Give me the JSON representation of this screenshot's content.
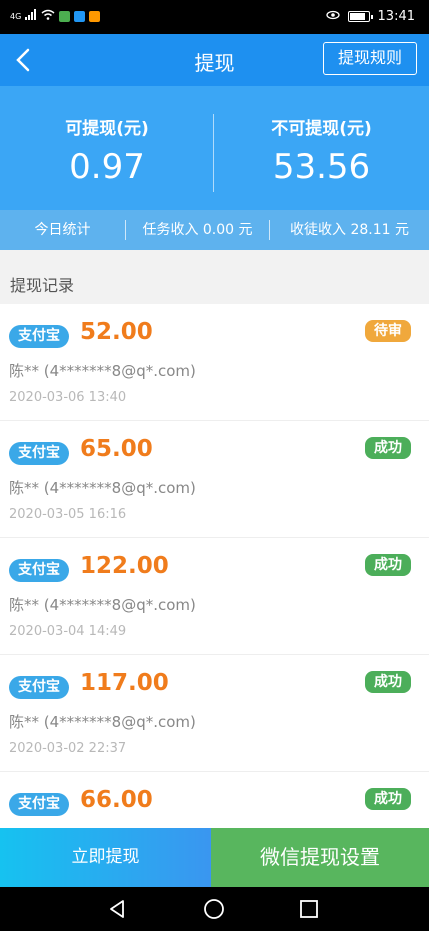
{
  "status_bar": {
    "network": "4G",
    "time": "13:41"
  },
  "header": {
    "title": "提现",
    "rule_button": "提现规则"
  },
  "balance": {
    "available_label": "可提现(元)",
    "available_value": "0.97",
    "unavailable_label": "不可提现(元)",
    "unavailable_value": "53.56"
  },
  "stats": {
    "today": "今日统计",
    "task_income": "任务收入 0.00 元",
    "apprentice_income": "收徒收入 28.11 元"
  },
  "section_title": "提现记录",
  "records": [
    {
      "method": "支付宝",
      "amount": "52.00",
      "status": "待审",
      "status_color": "#f0a83c",
      "account": "陈** (4*******8@q*.com)",
      "time": "2020-03-06 13:40"
    },
    {
      "method": "支付宝",
      "amount": "65.00",
      "status": "成功",
      "status_color": "#4cae5a",
      "account": "陈** (4*******8@q*.com)",
      "time": "2020-03-05 16:16"
    },
    {
      "method": "支付宝",
      "amount": "122.00",
      "status": "成功",
      "status_color": "#4cae5a",
      "account": "陈** (4*******8@q*.com)",
      "time": "2020-03-04 14:49"
    },
    {
      "method": "支付宝",
      "amount": "117.00",
      "status": "成功",
      "status_color": "#4cae5a",
      "account": "陈** (4*******8@q*.com)",
      "time": "2020-03-02 22:37"
    },
    {
      "method": "支付宝",
      "amount": "66.00",
      "status": "成功",
      "status_color": "#4cae5a",
      "account": "",
      "time": ""
    }
  ],
  "bottom": {
    "withdraw_now": "立即提现",
    "wechat_settings": "微信提现设置"
  },
  "icons": {
    "back": "back-arrow-icon",
    "nav_back": "triangle-back-icon",
    "nav_home": "circle-home-icon",
    "nav_recent": "square-recent-icon"
  }
}
